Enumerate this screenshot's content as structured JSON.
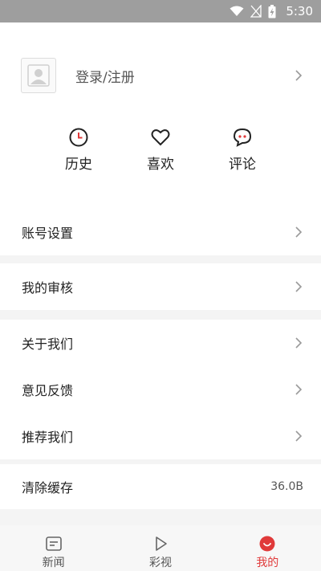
{
  "status_bar": {
    "time": "5:30"
  },
  "profile": {
    "login_label": "登录/注册"
  },
  "quick_actions": [
    {
      "label": "历史",
      "icon": "clock-icon"
    },
    {
      "label": "喜欢",
      "icon": "heart-icon"
    },
    {
      "label": "评论",
      "icon": "comment-icon"
    }
  ],
  "menu": {
    "account_settings": "账号设置",
    "my_review": "我的审核",
    "about_us": "关于我们",
    "feedback": "意见反馈",
    "recommend_us": "推荐我们",
    "clear_cache": "清除缓存",
    "cache_size": "36.0B"
  },
  "tabs": [
    {
      "label": "新闻",
      "icon": "news-icon",
      "active": false
    },
    {
      "label": "彩视",
      "icon": "play-icon",
      "active": false
    },
    {
      "label": "我的",
      "icon": "smile-icon",
      "active": true
    }
  ],
  "colors": {
    "accent": "#e03a3a",
    "status_bar": "#9e9e9e"
  }
}
